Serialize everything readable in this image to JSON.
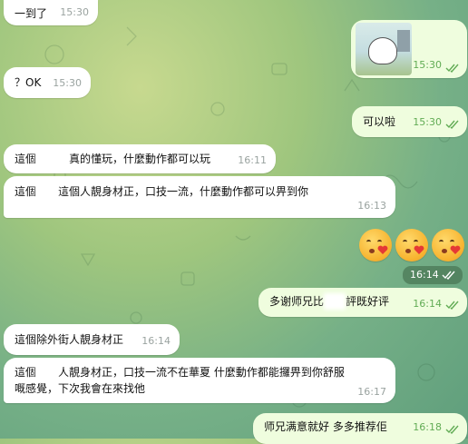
{
  "messages": [
    {
      "text": "一到了",
      "time": "15:30"
    },
    {
      "time": "15:30"
    },
    {
      "text": "？OK",
      "time": "15:30"
    },
    {
      "text": "可以啦",
      "time": "15:30"
    },
    {
      "text_a": "這個",
      "text_b": "真的懂玩，什麼動作都可以玩",
      "time": "16:11"
    },
    {
      "text_a": "這個",
      "text_b": "這個人靚身材正，口技一流，什麼動作都可以畀到你",
      "time": "16:13"
    },
    {
      "time": "16:14"
    },
    {
      "text_a": "多谢师兄比",
      "text_b": "評既好评",
      "time": "16:14"
    },
    {
      "text": "這個除外街人靚身材正",
      "time": "16:14"
    },
    {
      "line1_a": "這個",
      "line1_b": "人靚身材正，口技一流不在華夏 什麼動作都能攞畀到你舒服",
      "line2": "嘅感覺，下次我會在來找他",
      "time": "16:17"
    },
    {
      "text": "师兄满意就好 多多推荐佢",
      "time": "16:18"
    }
  ],
  "colors": {
    "incoming": "#ffffff",
    "outgoing": "#effdde",
    "check": "#62ac55"
  },
  "icons": {
    "read": "double-check-icon"
  }
}
